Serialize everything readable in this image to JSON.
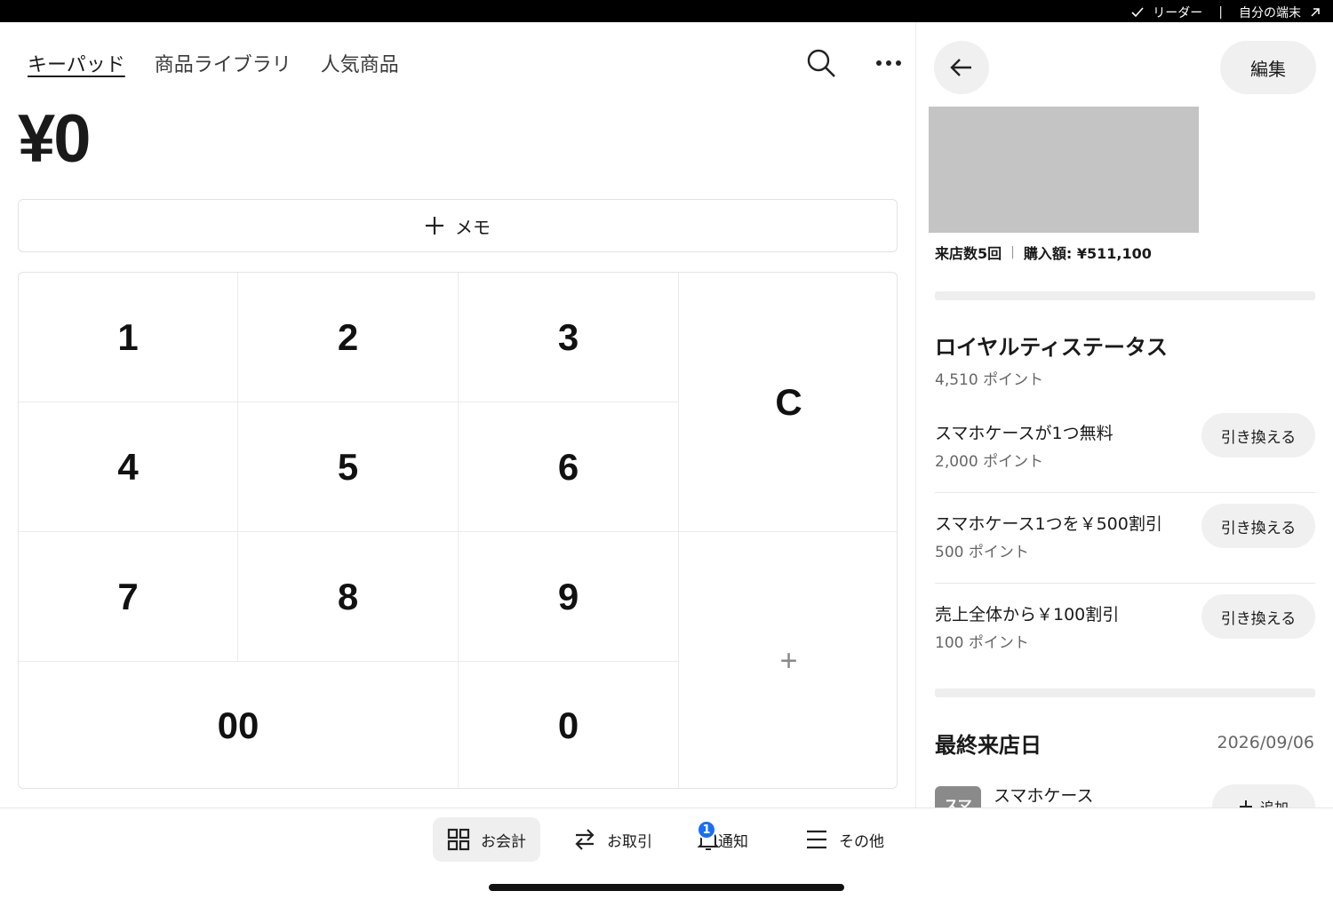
{
  "status_bar": {
    "reader_label": "リーダー",
    "device_label": "自分の端末"
  },
  "tabs": [
    {
      "label": "キーパッド",
      "active": true
    },
    {
      "label": "商品ライブラリ",
      "active": false
    },
    {
      "label": "人気商品",
      "active": false
    }
  ],
  "amount": "¥0",
  "memo_label": "メモ",
  "keypad": {
    "k1": "1",
    "k2": "2",
    "k3": "3",
    "k4": "4",
    "k5": "5",
    "k6": "6",
    "k7": "7",
    "k8": "8",
    "k9": "9",
    "k00": "00",
    "k0": "0",
    "clear": "C",
    "add": "+"
  },
  "customer": {
    "edit_label": "編集",
    "visits": "来店数5回",
    "purchase": "購入額: ¥511,100"
  },
  "loyalty": {
    "title": "ロイヤルティステータス",
    "points": "4,510 ポイント",
    "rewards": [
      {
        "title": "スマホケースが1つ無料",
        "points": "2,000 ポイント",
        "button": "引き換える"
      },
      {
        "title": "スマホケース1つを￥500割引",
        "points": "500 ポイント",
        "button": "引き換える"
      },
      {
        "title": "売上全体から￥100割引",
        "points": "100 ポイント",
        "button": "引き換える"
      }
    ]
  },
  "last_visit": {
    "title": "最終来店日",
    "date": "2026/09/06",
    "item_thumb": "スマ",
    "item_name": "スマホケース",
    "add_label": "追加"
  },
  "bottom_nav": {
    "checkout": "お会計",
    "transactions": "お取引",
    "notifications": "通知",
    "notifications_badge": "1",
    "more": "その他"
  },
  "colors": {
    "badge": "#1a6ef5",
    "photo_placeholder": "#c4c4c4",
    "button_bg": "#f0f0f0"
  }
}
